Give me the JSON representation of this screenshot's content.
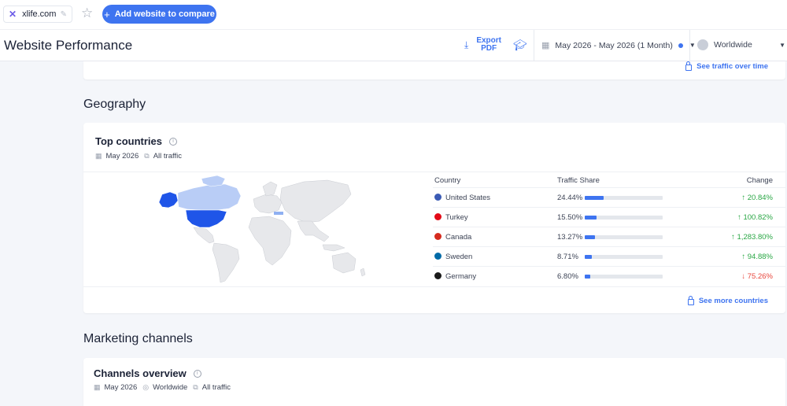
{
  "topbar": {
    "site": "xlife.com",
    "add_button": "Add website to compare"
  },
  "header": {
    "title": "Website Performance",
    "export_line1": "Export",
    "export_line2": "PDF",
    "date_range": "May 2026 - May 2026 (1 Month)",
    "region": "Worldwide"
  },
  "traffic_link": "See traffic over time",
  "geography": {
    "section_title": "Geography",
    "card_title": "Top countries",
    "date": "May 2026",
    "traffic_type": "All traffic",
    "columns": {
      "country": "Country",
      "share": "Traffic Share",
      "change": "Change"
    },
    "rows": [
      {
        "country": "United States",
        "share": "24.44%",
        "share_value": 24.44,
        "change": "↑ 20.84%",
        "dir": "up",
        "flag": "#3b5bb5"
      },
      {
        "country": "Turkey",
        "share": "15.50%",
        "share_value": 15.5,
        "change": "↑ 100.82%",
        "dir": "up",
        "flag": "#e30a17"
      },
      {
        "country": "Canada",
        "share": "13.27%",
        "share_value": 13.27,
        "change": "↑ 1,283.80%",
        "dir": "up",
        "flag": "#d52b1e"
      },
      {
        "country": "Sweden",
        "share": "8.71%",
        "share_value": 8.71,
        "change": "↑ 94.88%",
        "dir": "up",
        "flag": "#006aa7"
      },
      {
        "country": "Germany",
        "share": "6.80%",
        "share_value": 6.8,
        "change": "↓ 75.26%",
        "dir": "down",
        "flag": "#1a1a1a"
      }
    ],
    "more_link": "See more countries"
  },
  "marketing": {
    "section_title": "Marketing channels",
    "card_title": "Channels overview",
    "date": "May 2026",
    "region": "Worldwide",
    "traffic_type": "All traffic"
  },
  "colors": {
    "accent": "#3e74f0",
    "up": "#2aa745",
    "down": "#e8463c",
    "map_highlight": "#1f55e8",
    "map_light": "#b9cdf6",
    "map_base": "#e7e8eb"
  }
}
